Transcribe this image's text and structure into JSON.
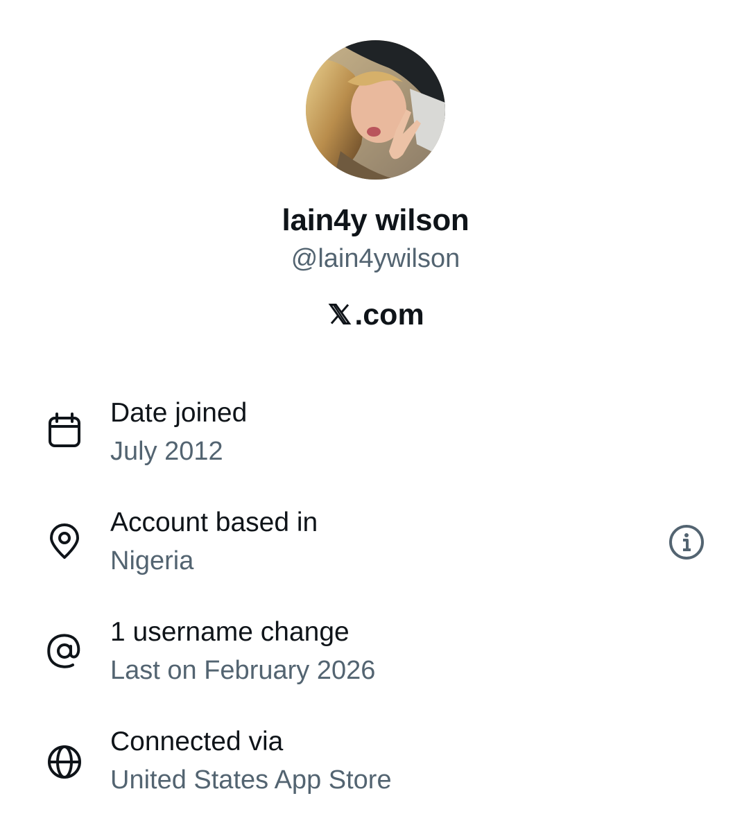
{
  "profile": {
    "display_name": "lain4y wilson",
    "handle": "@lain4ywilson",
    "site": ".com",
    "site_logo": "x-logo-icon"
  },
  "about": {
    "rows": [
      {
        "icon": "calendar-icon",
        "label": "Date joined",
        "value": "July 2012"
      },
      {
        "icon": "location-pin-icon",
        "label": "Account based in",
        "value": "Nigeria",
        "action_icon": "info-icon"
      },
      {
        "icon": "at-sign-icon",
        "label": "1 username change",
        "value": "Last on February 2026"
      },
      {
        "icon": "globe-icon",
        "label": "Connected via",
        "value": "United States App Store"
      }
    ]
  },
  "colors": {
    "primary_text": "#0f1419",
    "secondary_text": "#536471",
    "background": "#ffffff"
  }
}
